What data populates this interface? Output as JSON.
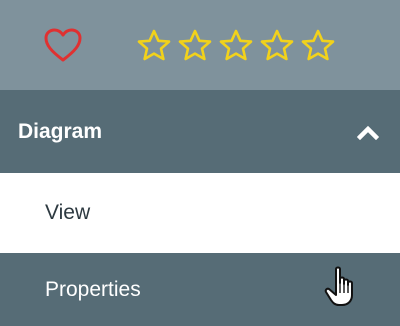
{
  "top_bar": {
    "heart_icon": "heart-outline-icon",
    "heart_color": "#e03131",
    "star_color": "#f2d21b",
    "rating": {
      "value": 0,
      "max": 5
    }
  },
  "section": {
    "title": "Diagram",
    "chevron_icon": "chevron-up-icon",
    "expanded": true
  },
  "menu": {
    "items": [
      {
        "label": "View"
      },
      {
        "label": "Properties"
      }
    ]
  },
  "cursor_icon": "hand-pointer-icon",
  "colors": {
    "top_bar_bg": "#7f929c",
    "header_bg": "#566c76",
    "item_bg_active": "#566c76",
    "item_bg_default": "#ffffff"
  }
}
